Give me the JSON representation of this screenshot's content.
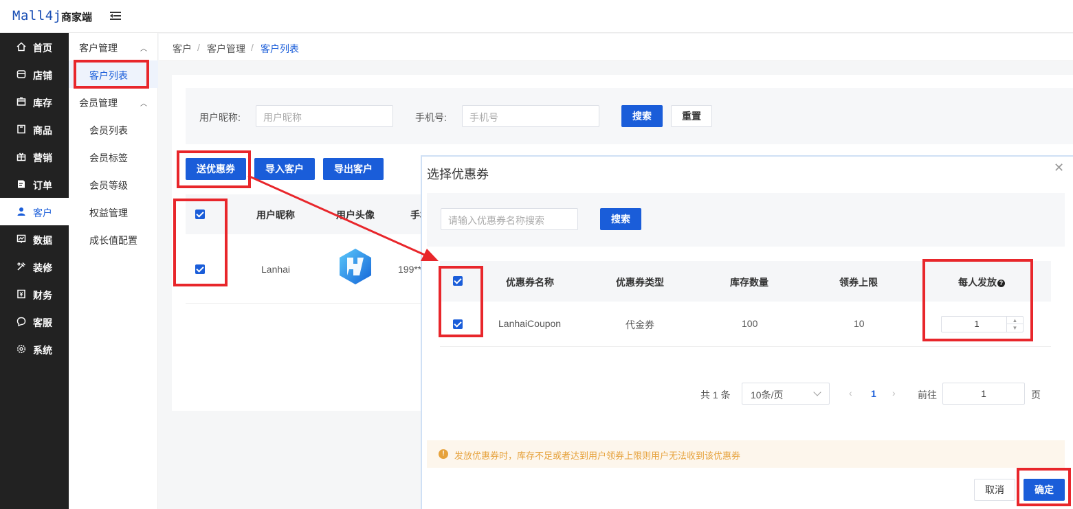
{
  "header": {
    "logo": "Mall4j",
    "subtitle": "商家端"
  },
  "sidebar": {
    "items": [
      {
        "label": "首页",
        "icon": "home-icon"
      },
      {
        "label": "店铺",
        "icon": "store-icon"
      },
      {
        "label": "库存",
        "icon": "inventory-icon"
      },
      {
        "label": "商品",
        "icon": "product-icon"
      },
      {
        "label": "营销",
        "icon": "gift-icon"
      },
      {
        "label": "订单",
        "icon": "order-icon"
      },
      {
        "label": "客户",
        "icon": "user-icon",
        "active": true
      },
      {
        "label": "数据",
        "icon": "chart-icon"
      },
      {
        "label": "装修",
        "icon": "decorate-icon"
      },
      {
        "label": "财务",
        "icon": "finance-icon"
      },
      {
        "label": "客服",
        "icon": "chat-icon"
      },
      {
        "label": "系统",
        "icon": "settings-icon"
      }
    ]
  },
  "submenu": {
    "group1": "客户管理",
    "customer_list": "客户列表",
    "group2": "会员管理",
    "member_list": "会员列表",
    "member_tags": "会员标签",
    "member_levels": "会员等级",
    "benefits": "权益管理",
    "growth": "成长值配置"
  },
  "breadcrumb": [
    "客户",
    "客户管理",
    "客户列表"
  ],
  "search": {
    "nickname_label": "用户昵称:",
    "nickname_placeholder": "用户昵称",
    "phone_label": "手机号:",
    "phone_placeholder": "手机号",
    "search_btn": "搜索",
    "reset_btn": "重置"
  },
  "actions": {
    "send_coupon": "送优惠券",
    "import": "导入客户",
    "export": "导出客户"
  },
  "customer_table": {
    "headers": [
      "用户昵称",
      "用户头像",
      "手机"
    ],
    "rows": [
      {
        "nickname": "Lanhai",
        "phone": "199**"
      }
    ]
  },
  "dialog": {
    "title": "选择优惠券",
    "search_placeholder": "请输入优惠券名称搜索",
    "search_btn": "搜索",
    "headers": [
      "优惠券名称",
      "优惠券类型",
      "库存数量",
      "领券上限",
      "每人发放"
    ],
    "rows": [
      {
        "name": "LanhaiCoupon",
        "type": "代金券",
        "stock": "100",
        "limit": "10",
        "per_person": "1"
      }
    ],
    "pager": {
      "total": "共 1 条",
      "page_size": "10条/页",
      "current": "1",
      "goto_label": "前往",
      "goto_value": "1",
      "page_unit": "页"
    },
    "notice": "发放优惠券时，库存不足或者达到用户领券上限则用户无法收到该优惠券",
    "cancel_btn": "取消",
    "confirm_btn": "确定"
  },
  "colors": {
    "primary": "#1a5dd9",
    "highlight": "#e8262b",
    "sidebar_bg": "#222222",
    "warning": "#e6a23c"
  }
}
